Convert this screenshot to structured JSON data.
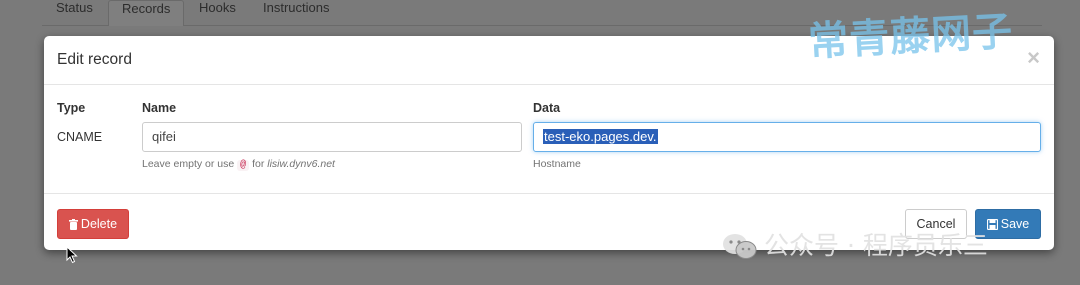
{
  "tabs": [
    {
      "label": "Status"
    },
    {
      "label": "Records"
    },
    {
      "label": "Hooks"
    },
    {
      "label": "Instructions"
    }
  ],
  "modal": {
    "title": "Edit record",
    "close_glyph": "×",
    "type_header": "Type",
    "name_header": "Name",
    "data_header": "Data",
    "type_value": "CNAME",
    "name_value": "qifei",
    "data_value": "test-eko.pages.dev.",
    "name_help_prefix": "Leave empty or use",
    "name_help_code": "@",
    "name_help_for": "for",
    "name_help_domain": "lisiw.dynv6.net",
    "data_help": "Hostname",
    "delete_label": "Delete",
    "cancel_label": "Cancel",
    "save_label": "Save"
  },
  "watermark": {
    "top": "常青藤网子",
    "bottom": "公众号 · 程序员乐三"
  },
  "colors": {
    "danger": "#d9534f",
    "primary": "#337ab7",
    "selection": "#2a5fb8",
    "overlay": "#7a7a7a"
  },
  "icons": [
    "trash-icon",
    "floppy-disk-icon",
    "close-icon",
    "wechat-icon",
    "mouse-cursor-icon"
  ]
}
